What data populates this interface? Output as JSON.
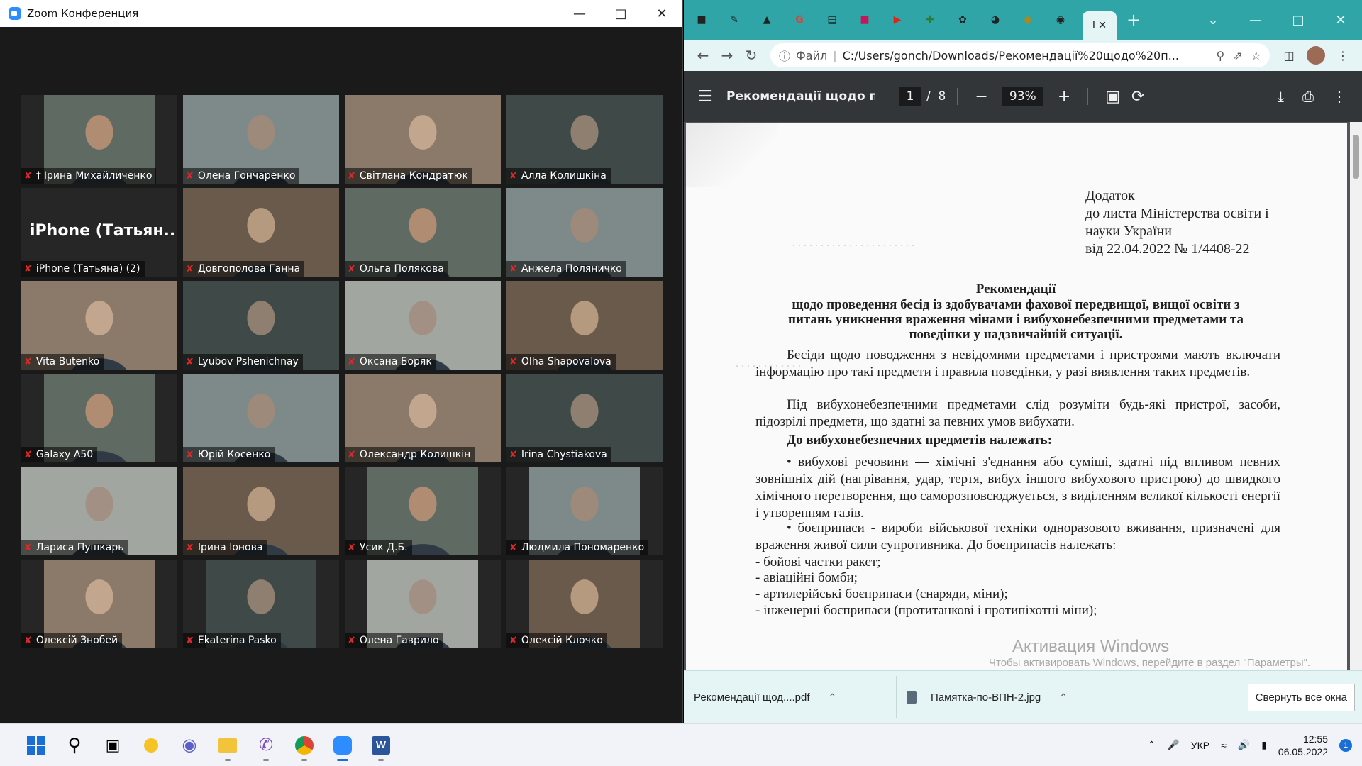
{
  "zoom": {
    "title": "Zoom Конференция",
    "participants": [
      {
        "name": "Ірина Михайличенко",
        "pinned": true
      },
      {
        "name": "Олена Гончаренко"
      },
      {
        "name": "Світлана Кондратюк"
      },
      {
        "name": "Алла Колишкіна",
        "speaking": true
      },
      {
        "name": "iPhone (Татьяна) (2)",
        "big_label": "iPhone (Татьян..."
      },
      {
        "name": "Довгополова Ганна"
      },
      {
        "name": "Ольга Полякова"
      },
      {
        "name": "Анжела Поляничко"
      },
      {
        "name": "Vita Butenko"
      },
      {
        "name": "Lyubov Pshenichnay"
      },
      {
        "name": "Оксана Боряк"
      },
      {
        "name": "Olha Shapovalova"
      },
      {
        "name": "Galaxy A50"
      },
      {
        "name": "Юрій Косенко"
      },
      {
        "name": "Олександр Колишкін"
      },
      {
        "name": "Irina Chystiakova"
      },
      {
        "name": "Лариса Пушкарь"
      },
      {
        "name": "Ірина Іонова"
      },
      {
        "name": "Усик Д.Б."
      },
      {
        "name": "Людмила Пономаренко"
      },
      {
        "name": "Олексій Знобей"
      },
      {
        "name": "Ekaterina Pasko"
      },
      {
        "name": "Олена Гаврило"
      },
      {
        "name": "Олексій Клочко"
      }
    ]
  },
  "chrome": {
    "active_tab_label": "I",
    "omnibox": {
      "scheme_label": "Файл",
      "url": "C:/Users/gonch/Downloads/Рекомендації%20щодо%20п..."
    },
    "pdf": {
      "title": "Рекомендації щодо п...",
      "page_current": "1",
      "page_total": "8",
      "zoom": "93%"
    },
    "document": {
      "addendum": [
        "Додаток",
        "до листа Міністерства освіти і",
        "науки України",
        "від 22.04.2022 № 1/4408-22"
      ],
      "title_lines": [
        "Рекомендації",
        "щодо проведення бесід із здобувачами фахової передвищої, вищої освіти з",
        "питань уникнення враження мінами і вибухонебезпечними предметами та",
        "поведінки у надзвичайній ситуації."
      ],
      "para1": "Бесіди щодо поводження з невідомими предметами і пристроями мають включати інформацію про такі предмети і правила поведінки, у разі виявлення таких предметів.",
      "para2": "Під вибухонебезпечними предметами слід розуміти будь-які пристрої, засоби, підозрілі предмети, що здатні за певних умов вибухати.",
      "heading": "До вибухонебезпечних предметів належать:",
      "para3": "• вибухові речовини — хімічні з'єднання або суміші, здатні під впливом певних зовнішніх дій (нагрівання, удар, тертя, вибух іншого вибухового пристрою) до швидкого хімічного перетворення, що саморозповсюджується, з виділенням великої кількості енергії і утворенням газів.",
      "para4": "• боєприпаси - вироби військової техніки одноразового вживання, призначені для враження живої сили супротивника. До боєприпасів належать:",
      "list": [
        "- бойові частки ракет;",
        "- авіаційні бомби;",
        "- артилерійські боєприпаси (снаряди, міни);",
        "- інженерні боєприпаси (протитанкові і протипіхотні міни);"
      ]
    },
    "watermark": {
      "title": "Активация Windows",
      "subtitle": "Чтобы активировать Windows, перейдите в раздел \"Параметры\"."
    },
    "downloads": {
      "items": [
        "Рекомендації щод....pdf",
        "Памятка-по-ВПН-2.jpg"
      ],
      "collapse_label": "Свернуть все окна"
    }
  },
  "taskbar": {
    "language": "УКР",
    "time": "12:55",
    "date": "06.05.2022",
    "notification_count": "1"
  }
}
